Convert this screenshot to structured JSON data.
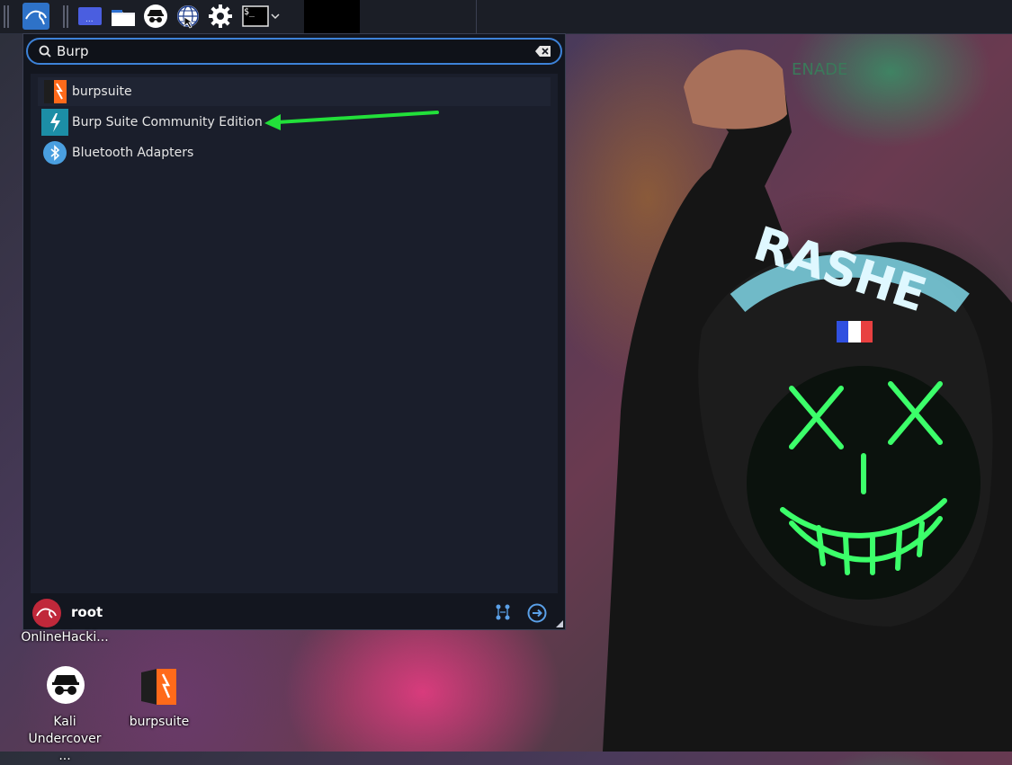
{
  "colors": {
    "accent": "#3d82d8",
    "panel_bg": "#1b1e26",
    "menu_bg": "#13161f",
    "annotation_arrow": "#22e03a"
  },
  "taskbar": {
    "icons": [
      "kali-menu-icon",
      "workspace-icon",
      "file-manager-icon",
      "undercover-icon",
      "web-browser-icon",
      "settings-icon",
      "terminal-icon",
      "chevron-down-icon"
    ],
    "terminal_glyph": "$_"
  },
  "menu": {
    "search": {
      "value": "Burp",
      "placeholder": ""
    },
    "results": [
      {
        "label": "burpsuite",
        "icon": "burpsuite-icon"
      },
      {
        "label": "Burp Suite Community Edition",
        "icon": "burp-community-icon"
      },
      {
        "label": "Bluetooth Adapters",
        "icon": "bluetooth-icon"
      }
    ],
    "footer": {
      "user": "root",
      "icons": [
        "network-icon",
        "logout-icon"
      ]
    }
  },
  "desktop": {
    "icons": [
      {
        "label": "OnlineHacki...",
        "icon": "folder-icon"
      },
      {
        "label": "Kali Undercover ...",
        "icon": "undercover-icon"
      },
      {
        "label": "burpsuite",
        "icon": "burpsuite-icon"
      }
    ]
  },
  "wallpaper": {
    "hood_text": "RASHE",
    "sign_text": "ENADE"
  }
}
